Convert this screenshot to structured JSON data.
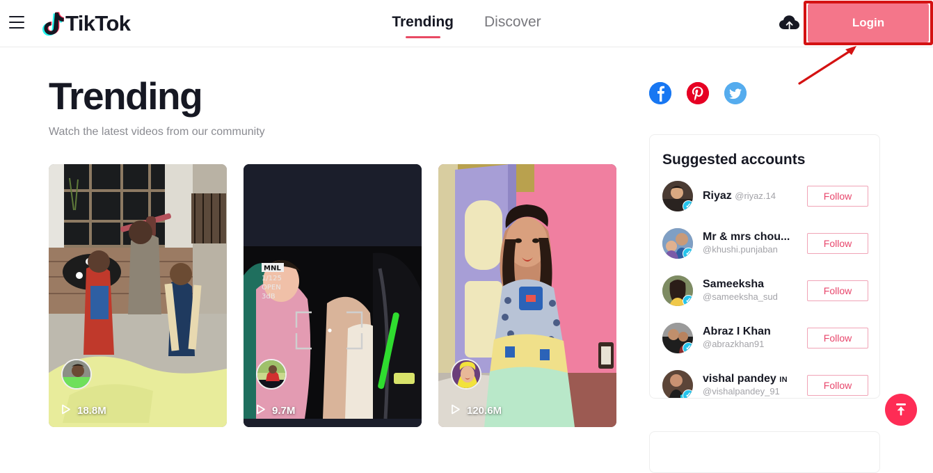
{
  "header": {
    "menu_icon": "hamburger-menu-icon",
    "logo_text": "TikTok",
    "logo_icon": "tiktok-note-icon",
    "upload_icon": "cloud-upload-icon",
    "nav": [
      {
        "label": "Trending",
        "active": true
      },
      {
        "label": "Discover",
        "active": false
      }
    ],
    "login_label": "Login",
    "login_bg": "#f4768a",
    "annotation_color": "#d41212"
  },
  "main": {
    "title": "Trending",
    "subtitle": "Watch the latest videos from our community",
    "videos": [
      {
        "views": "18.8M",
        "play_icon": "play-triangle-icon",
        "avatar": "video-avatar"
      },
      {
        "views": "9.7M",
        "play_icon": "play-triangle-icon",
        "avatar": "video-avatar",
        "overlay": {
          "mode": "MNL",
          "shutter": "1/125",
          "iris": "OPEN",
          "gain": "3dB"
        }
      },
      {
        "views": "120.6M",
        "play_icon": "play-triangle-icon",
        "avatar": "video-avatar"
      }
    ]
  },
  "rail": {
    "socials": [
      {
        "name": "facebook-icon",
        "glyph": "f",
        "color": "#1877f2"
      },
      {
        "name": "pinterest-icon",
        "glyph": "P",
        "color": "#e60023"
      },
      {
        "name": "twitter-icon",
        "glyph": "ᴠ",
        "color": "#55acee"
      }
    ],
    "suggested_title": "Suggested accounts",
    "accounts": [
      {
        "name": "Riyaz",
        "handle": "@riyaz.14",
        "follow": "Follow",
        "verified": true,
        "region": ""
      },
      {
        "name": "Mr & mrs chou...",
        "handle": "@khushi.punjaban",
        "follow": "Follow",
        "verified": true,
        "region": ""
      },
      {
        "name": "Sameeksha",
        "handle": "@sameeksha_sud",
        "follow": "Follow",
        "verified": true,
        "region": ""
      },
      {
        "name": "Abraz I Khan",
        "handle": "@abrazkhan91",
        "follow": "Follow",
        "verified": true,
        "region": ""
      },
      {
        "name": "vishal pandey",
        "handle": "@vishalpandey_91",
        "follow": "Follow",
        "verified": true,
        "region": "IN"
      }
    ]
  },
  "fab": {
    "icon": "scroll-to-top-icon",
    "color": "#fe2c55"
  }
}
